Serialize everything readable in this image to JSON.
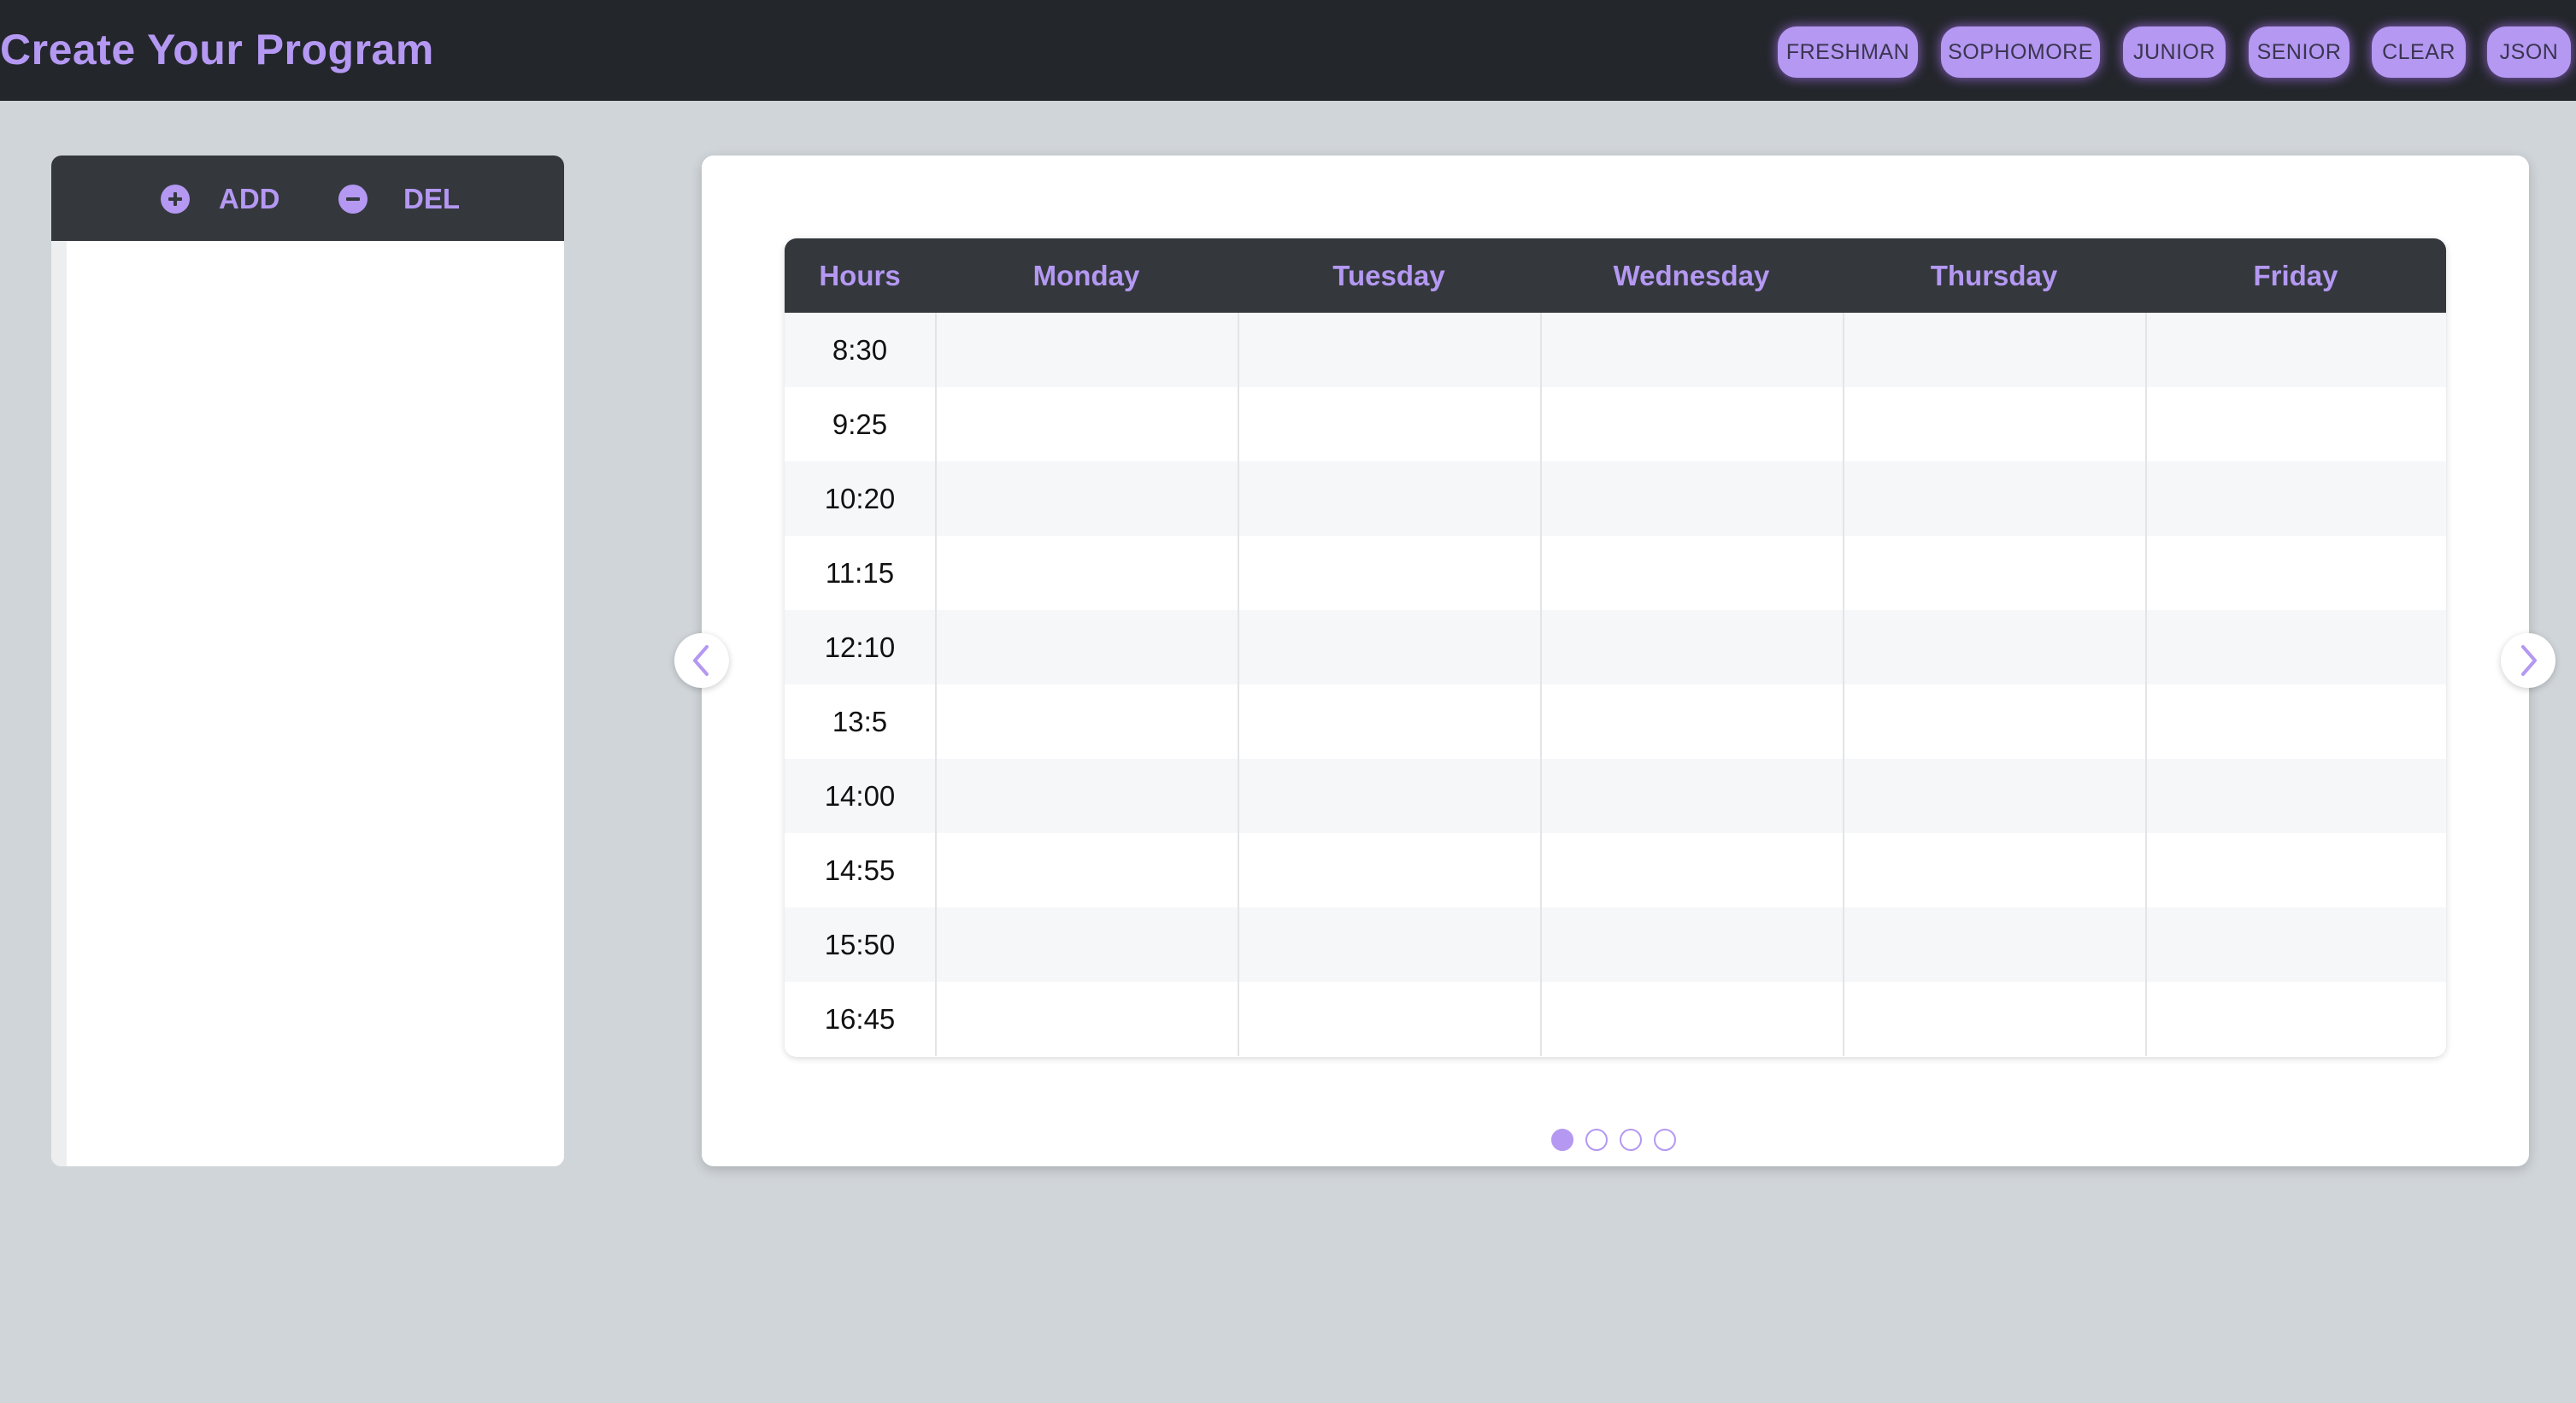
{
  "header": {
    "title": "Create Your Program",
    "buttons": [
      "FRESHMAN",
      "SOPHOMORE",
      "JUNIOR",
      "SENIOR",
      "CLEAR",
      "JSON"
    ]
  },
  "course_panel": {
    "add_label": "ADD",
    "del_label": "DEL",
    "icons": {
      "add": "plus-circle-icon",
      "del": "minus-circle-icon"
    }
  },
  "timetable": {
    "hours_header": "Hours",
    "days": [
      "Monday",
      "Tuesday",
      "Wednesday",
      "Thursday",
      "Friday"
    ],
    "hours": [
      "8:30",
      "9:25",
      "10:20",
      "11:15",
      "12:10",
      "13:5",
      "14:00",
      "14:55",
      "15:50",
      "16:45"
    ]
  },
  "carousel": {
    "prev_icon": "chevron-left-icon",
    "next_icon": "chevron-right-icon",
    "page_count": 4,
    "active_page": 1
  },
  "colors": {
    "accent": "#b498f2",
    "header_bg": "#23262b",
    "panel_header_bg": "#34383d",
    "page_bg": "#d0d5d9"
  }
}
